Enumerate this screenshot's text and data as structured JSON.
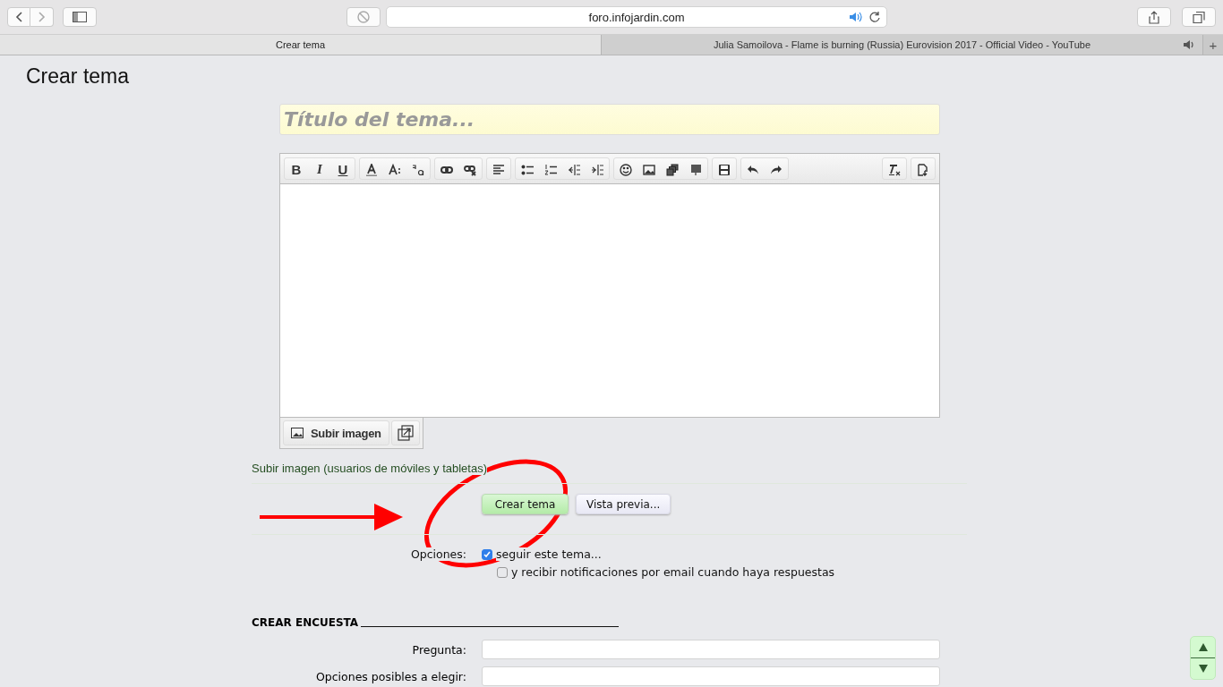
{
  "browser": {
    "address": "foro.infojardin.com",
    "tabs": [
      {
        "title": "Crear tema",
        "selected": true,
        "audio": false
      },
      {
        "title": "Julia Samoilova - Flame is burning (Russia) Eurovision 2017 - Official Video - YouTube",
        "selected": false,
        "audio": true
      }
    ],
    "new_tab": "+"
  },
  "page_title": "Crear tema",
  "title_field": {
    "placeholder": "Título del tema..."
  },
  "editor_toolbar": [
    {
      "buttons": [
        {
          "kind": "bold",
          "glyph": "B"
        },
        {
          "kind": "italic",
          "glyph": "I"
        },
        {
          "kind": "underline",
          "glyph": "U"
        }
      ]
    },
    {
      "buttons": [
        {
          "kind": "fontcolor"
        },
        {
          "kind": "fontsize"
        },
        {
          "kind": "case"
        }
      ]
    },
    {
      "buttons": [
        {
          "kind": "link"
        },
        {
          "kind": "unlink"
        }
      ]
    },
    {
      "buttons": [
        {
          "kind": "align"
        }
      ]
    },
    {
      "buttons": [
        {
          "kind": "bullets"
        },
        {
          "kind": "numbers"
        },
        {
          "kind": "outdent"
        },
        {
          "kind": "indent"
        }
      ]
    },
    {
      "buttons": [
        {
          "kind": "smiley"
        },
        {
          "kind": "image"
        },
        {
          "kind": "media"
        },
        {
          "kind": "code"
        }
      ]
    },
    {
      "buttons": [
        {
          "kind": "save"
        }
      ]
    },
    {
      "buttons": [
        {
          "kind": "undo"
        },
        {
          "kind": "redo"
        }
      ]
    }
  ],
  "editor_toolbar_right": [
    {
      "buttons": [
        {
          "kind": "clear"
        }
      ]
    },
    {
      "buttons": [
        {
          "kind": "toggle"
        }
      ]
    }
  ],
  "upload_button": "Subir imagen",
  "mobile_upload_link": "Subir imagen (usuarios de móviles y tabletas)",
  "actions": [
    {
      "label": "Crear tema",
      "kind": "primary"
    },
    {
      "label": "Vista previa...",
      "kind": "secondary"
    }
  ],
  "options": {
    "label": "Opciones:",
    "items": [
      {
        "label": "seguir este tema...",
        "checked": true
      },
      {
        "label": "y recibir notificaciones por email cuando haya respuestas",
        "checked": false
      }
    ]
  },
  "poll": {
    "heading": "CREAR ENCUESTA",
    "fields": [
      {
        "label": "Pregunta:"
      },
      {
        "label": "Opciones posibles a elegir:"
      }
    ]
  },
  "annotations": {
    "arrow": true,
    "ellipse": true
  }
}
